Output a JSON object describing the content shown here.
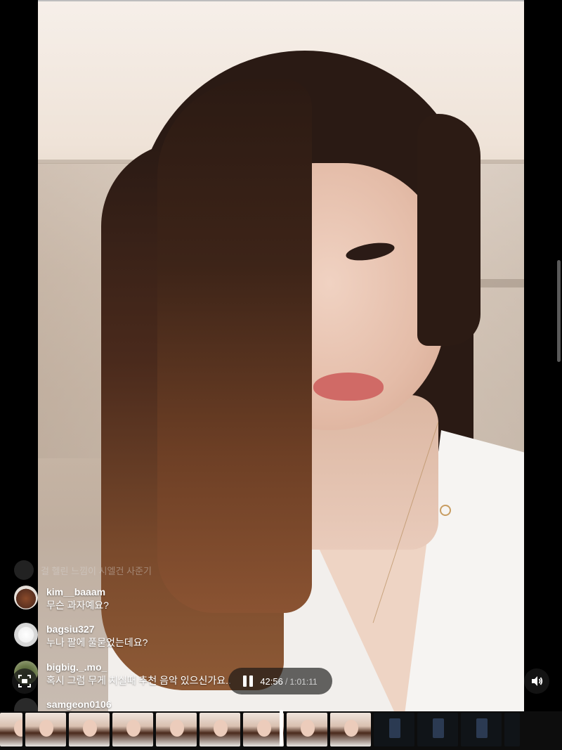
{
  "comments": [
    {
      "user": "kim__baaam",
      "message": "무슨 과자예요?",
      "avatar": "photo-avatar"
    },
    {
      "user": "bagsiu327",
      "message": "누나 팔에 풀묻었는데요?",
      "avatar": "default-avatar"
    },
    {
      "user": "bigbig._.mo_",
      "message": "혹시 그럼 무게 치실때 추천 음악 있으신가요..",
      "avatar": "photo-avatar"
    },
    {
      "user": "samgeon0106",
      "message": "",
      "avatar": "photo-avatar"
    }
  ],
  "faded_comment": "걸 헬린 느낌이 시엘건 사준기",
  "player": {
    "current_time": "42:56",
    "separator": "/",
    "total_time": "1:01:11",
    "state": "playing"
  },
  "icons": {
    "pause": "pause-icon",
    "volume": "volume-icon",
    "capture": "screen-capture-icon"
  },
  "colors": {
    "background": "#000000",
    "overlay": "#141414"
  }
}
